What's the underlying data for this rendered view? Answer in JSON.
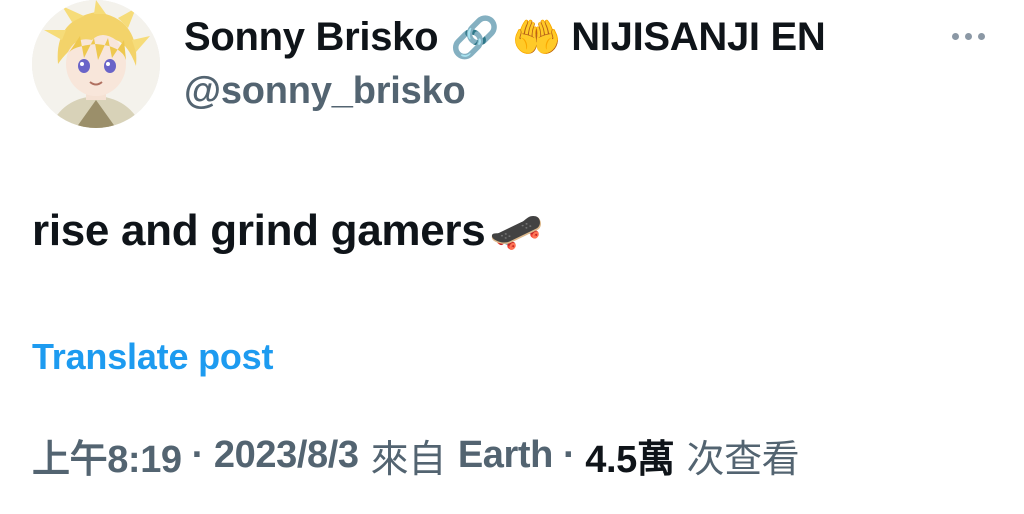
{
  "profile": {
    "display_name": "Sonny Brisko",
    "emoji_link": "🔗",
    "emoji_hands": "🤲",
    "affiliation": "NIJISANJI EN",
    "handle": "@sonny_brisko"
  },
  "tweet": {
    "text": "rise and grind gamers",
    "emoji": "🛹"
  },
  "translate_label": "Translate post",
  "meta": {
    "time": "上午8:19",
    "separator": "·",
    "date": "2023/8/3",
    "via": "來自",
    "source": "Earth",
    "views_count": "4.5萬",
    "views_label": "次查看"
  },
  "colors": {
    "text": "#0f1419",
    "secondary": "#536471",
    "link": "#1d9bf0"
  },
  "icons": {
    "more": "more-horizontal-icon"
  }
}
